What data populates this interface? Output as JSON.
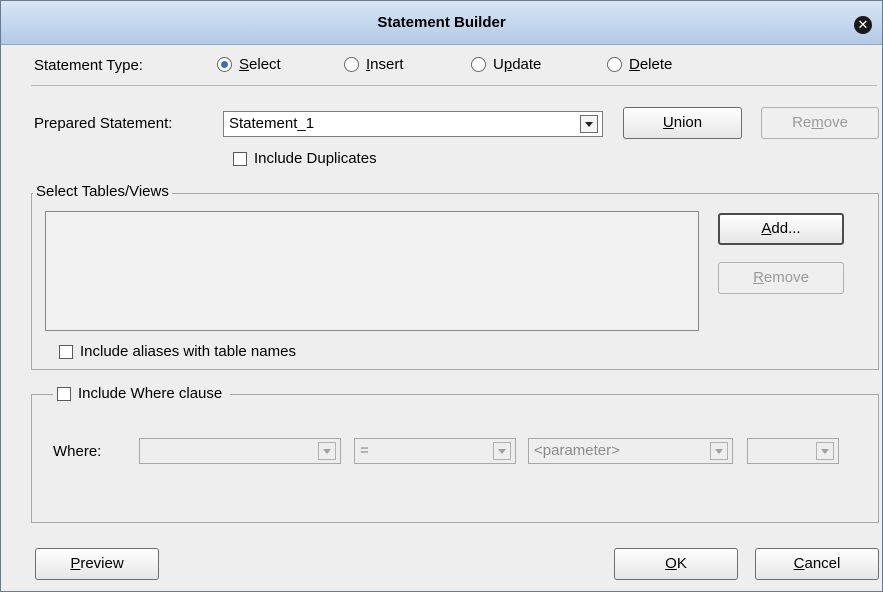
{
  "window": {
    "title": "Statement Builder"
  },
  "statement_type": {
    "label": "Statement Type:",
    "options": [
      {
        "label": "Select",
        "mnemonic": "S",
        "rest": "elect",
        "selected": true
      },
      {
        "label": "Insert",
        "mnemonic": "I",
        "rest": "nsert",
        "selected": false
      },
      {
        "label": "Update",
        "pre": "U",
        "mnemonic": "p",
        "rest": "date",
        "selected": false
      },
      {
        "label": "Delete",
        "mnemonic": "D",
        "rest": "elete",
        "selected": false
      }
    ]
  },
  "prepared": {
    "label": "Prepared Statement:",
    "value": "Statement_1",
    "union_button": {
      "mnemonic": "U",
      "rest": "nion"
    },
    "remove_button": {
      "pre": "Re",
      "mnemonic": "m",
      "rest": "ove"
    },
    "include_duplicates": {
      "label": "Include Duplicates",
      "checked": false
    }
  },
  "tables": {
    "legend": "Select Tables/Views",
    "add_button": {
      "mnemonic": "A",
      "rest": "dd..."
    },
    "remove_button": {
      "mnemonic": "R",
      "rest": "emove"
    },
    "include_aliases": {
      "label": "Include aliases with table names",
      "checked": false
    }
  },
  "where": {
    "legend_check": {
      "label": "Include Where clause",
      "checked": false
    },
    "label": "Where:",
    "column": "",
    "operator": "=",
    "parameter": "<parameter>",
    "connector": ""
  },
  "footer": {
    "preview_button": {
      "mnemonic": "P",
      "rest": "review"
    },
    "ok_button": {
      "mnemonic": "O",
      "rest": "K"
    },
    "cancel_button": {
      "mnemonic": "C",
      "rest": "ancel"
    }
  }
}
